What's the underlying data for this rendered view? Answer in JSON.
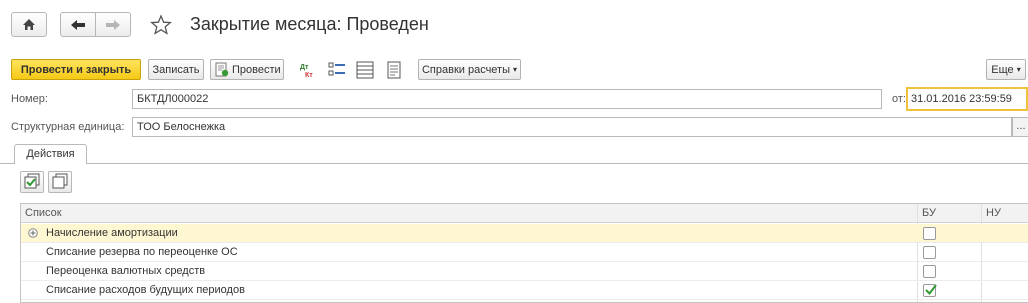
{
  "window": {
    "title": "Закрытие месяца: Проведен"
  },
  "toolbar": {
    "post_close_label": "Провести и закрыть",
    "save_label": "Записать",
    "post_label": "Провести",
    "reports_label": "Справки расчеты",
    "more_label": "Еще"
  },
  "form": {
    "number_label": "Номер:",
    "number_value": "БКТДЛ000022",
    "date_label": "от:",
    "date_value": "31.01.2016 23:59:59",
    "unit_label": "Структурная единица:",
    "unit_value": "ТОО Белоснежка",
    "unit_select_label": "..."
  },
  "tabs": [
    {
      "label": "Действия"
    }
  ],
  "table": {
    "columns": [
      "Список",
      "БУ",
      "НУ"
    ],
    "rows": [
      {
        "label": "Начисление амортизации",
        "bu": false,
        "selected": true
      },
      {
        "label": "Списание резерва по переоценке ОС",
        "bu": false,
        "selected": false
      },
      {
        "label": "Переоценка валютных средств",
        "bu": false,
        "selected": false
      },
      {
        "label": "Списание расходов будущих периодов",
        "bu": true,
        "selected": false
      }
    ]
  },
  "colors": {
    "primary_button": "#f5c916",
    "focus_border": "#f0c23c",
    "selected_row": "#fff7d1",
    "check_mark": "#2f9a2f"
  }
}
